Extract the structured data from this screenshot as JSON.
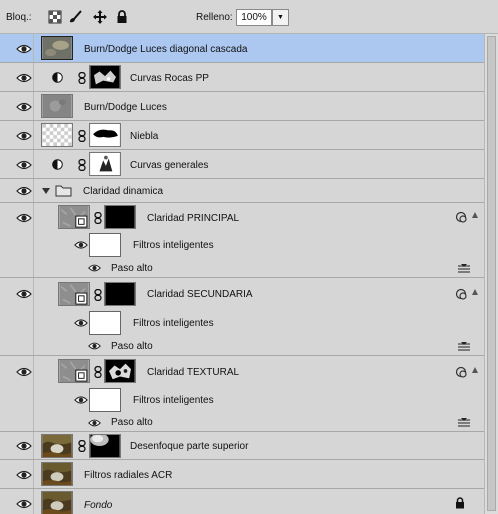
{
  "toolbar": {
    "lock_label": "Bloq.:",
    "fill_label": "Relleno:",
    "fill_value": "100%"
  },
  "layers": [
    {
      "name": "Burn/Dodge Luces diagonal cascada",
      "selected": true
    },
    {
      "name": "Curvas  Rocas PP"
    },
    {
      "name": "Burn/Dodge Luces"
    },
    {
      "name": "Niebla"
    },
    {
      "name": "Curvas generales"
    },
    {
      "name": "Claridad dinamica"
    },
    {
      "name": "Claridad PRINCIPAL",
      "filters_label": "Filtros inteligentes",
      "filter_name": "Paso alto"
    },
    {
      "name": "Claridad SECUNDARIA",
      "filters_label": "Filtros inteligentes",
      "filter_name": "Paso alto"
    },
    {
      "name": "Claridad TEXTURAL",
      "filters_label": "Filtros inteligentes",
      "filter_name": "Paso alto"
    },
    {
      "name": "Desenfoque parte superior"
    },
    {
      "name": "Filtros radiales ACR"
    },
    {
      "name": "Fondo"
    }
  ],
  "colors": {
    "selection": "#adc8f0",
    "panel": "#d6d6d6"
  }
}
